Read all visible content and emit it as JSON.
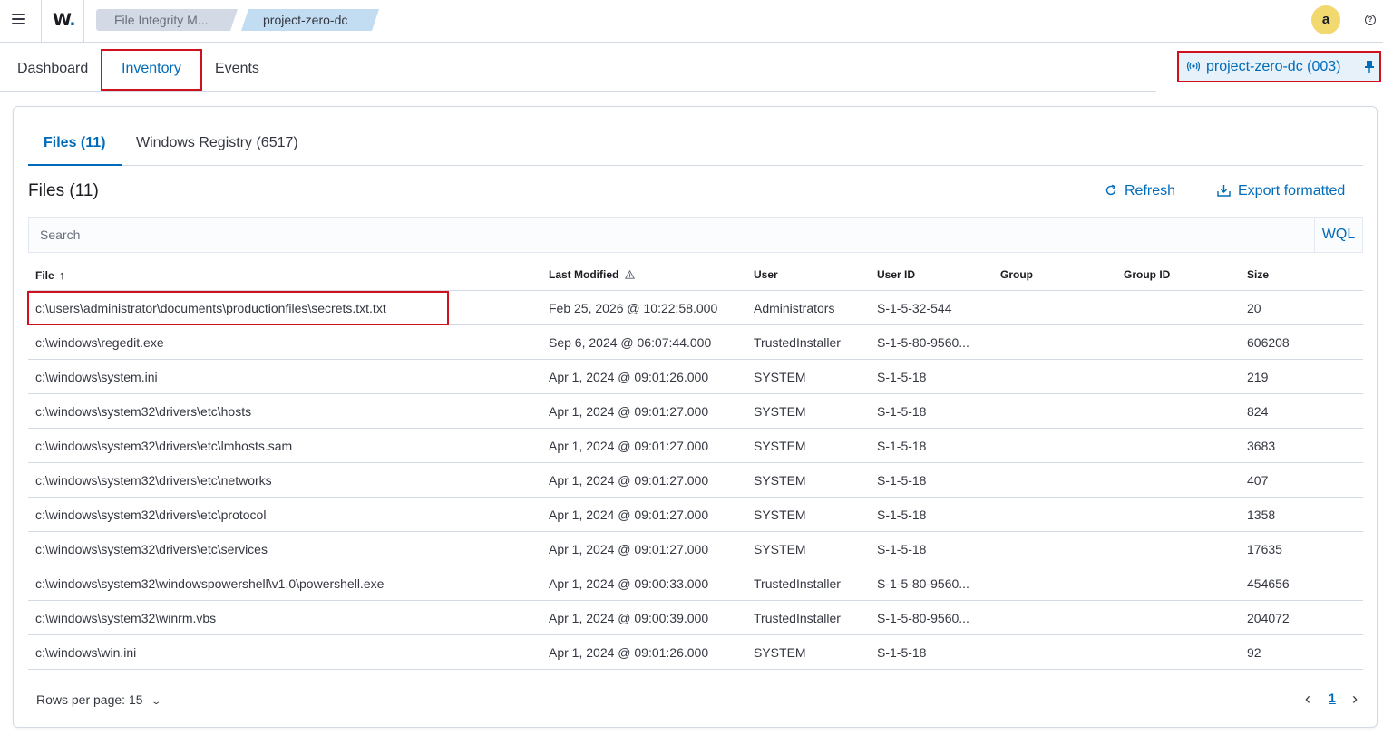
{
  "header": {
    "logo_text": "W",
    "logo_dot": ".",
    "breadcrumb": [
      "File Integrity M...",
      "project-zero-dc"
    ],
    "avatar_initial": "a",
    "help_glyph": "?"
  },
  "nav": {
    "tabs": [
      "Dashboard",
      "Inventory",
      "Events"
    ],
    "active": "Inventory",
    "agent_label": "project-zero-dc (003)"
  },
  "panel": {
    "subtabs": [
      "Files (11)",
      "Windows Registry (6517)"
    ],
    "title": "Files (11)",
    "refresh_label": "Refresh",
    "export_label": "Export formatted",
    "search_placeholder": "Search",
    "wql_label": "WQL"
  },
  "table": {
    "columns": [
      "File",
      "Last Modified",
      "User",
      "User ID",
      "Group",
      "Group ID",
      "Size"
    ],
    "sort_indicator": "↑",
    "rows": [
      {
        "file": "c:\\users\\administrator\\documents\\productionfiles\\secrets.txt.txt",
        "modified": "Feb 25, 2026 @ 10:22:58.000",
        "user": "Administrators",
        "uid": "S-1-5-32-544",
        "group": "",
        "gid": "",
        "size": "20"
      },
      {
        "file": "c:\\windows\\regedit.exe",
        "modified": "Sep 6, 2024 @ 06:07:44.000",
        "user": "TrustedInstaller",
        "uid": "S-1-5-80-9560...",
        "group": "",
        "gid": "",
        "size": "606208"
      },
      {
        "file": "c:\\windows\\system.ini",
        "modified": "Apr 1, 2024 @ 09:01:26.000",
        "user": "SYSTEM",
        "uid": "S-1-5-18",
        "group": "",
        "gid": "",
        "size": "219"
      },
      {
        "file": "c:\\windows\\system32\\drivers\\etc\\hosts",
        "modified": "Apr 1, 2024 @ 09:01:27.000",
        "user": "SYSTEM",
        "uid": "S-1-5-18",
        "group": "",
        "gid": "",
        "size": "824"
      },
      {
        "file": "c:\\windows\\system32\\drivers\\etc\\lmhosts.sam",
        "modified": "Apr 1, 2024 @ 09:01:27.000",
        "user": "SYSTEM",
        "uid": "S-1-5-18",
        "group": "",
        "gid": "",
        "size": "3683"
      },
      {
        "file": "c:\\windows\\system32\\drivers\\etc\\networks",
        "modified": "Apr 1, 2024 @ 09:01:27.000",
        "user": "SYSTEM",
        "uid": "S-1-5-18",
        "group": "",
        "gid": "",
        "size": "407"
      },
      {
        "file": "c:\\windows\\system32\\drivers\\etc\\protocol",
        "modified": "Apr 1, 2024 @ 09:01:27.000",
        "user": "SYSTEM",
        "uid": "S-1-5-18",
        "group": "",
        "gid": "",
        "size": "1358"
      },
      {
        "file": "c:\\windows\\system32\\drivers\\etc\\services",
        "modified": "Apr 1, 2024 @ 09:01:27.000",
        "user": "SYSTEM",
        "uid": "S-1-5-18",
        "group": "",
        "gid": "",
        "size": "17635"
      },
      {
        "file": "c:\\windows\\system32\\windowspowershell\\v1.0\\powershell.exe",
        "modified": "Apr 1, 2024 @ 09:00:33.000",
        "user": "TrustedInstaller",
        "uid": "S-1-5-80-9560...",
        "group": "",
        "gid": "",
        "size": "454656"
      },
      {
        "file": "c:\\windows\\system32\\winrm.vbs",
        "modified": "Apr 1, 2024 @ 09:00:39.000",
        "user": "TrustedInstaller",
        "uid": "S-1-5-80-9560...",
        "group": "",
        "gid": "",
        "size": "204072"
      },
      {
        "file": "c:\\windows\\win.ini",
        "modified": "Apr 1, 2024 @ 09:01:26.000",
        "user": "SYSTEM",
        "uid": "S-1-5-18",
        "group": "",
        "gid": "",
        "size": "92"
      }
    ]
  },
  "footer": {
    "rows_per_page_label": "Rows per page: 15",
    "current_page": "1"
  },
  "colors": {
    "accent": "#006bb8",
    "highlight_border": "#d1101e",
    "avatar_bg": "#f1d86f",
    "breadcrumb_active": "#c2dcf1"
  },
  "icons": [
    "menu-icon",
    "help-icon",
    "signal-icon",
    "pin-icon",
    "refresh-icon",
    "export-icon",
    "sort-up-icon",
    "warning-icon",
    "chevron-down-icon",
    "chevron-left-icon",
    "chevron-right-icon"
  ]
}
